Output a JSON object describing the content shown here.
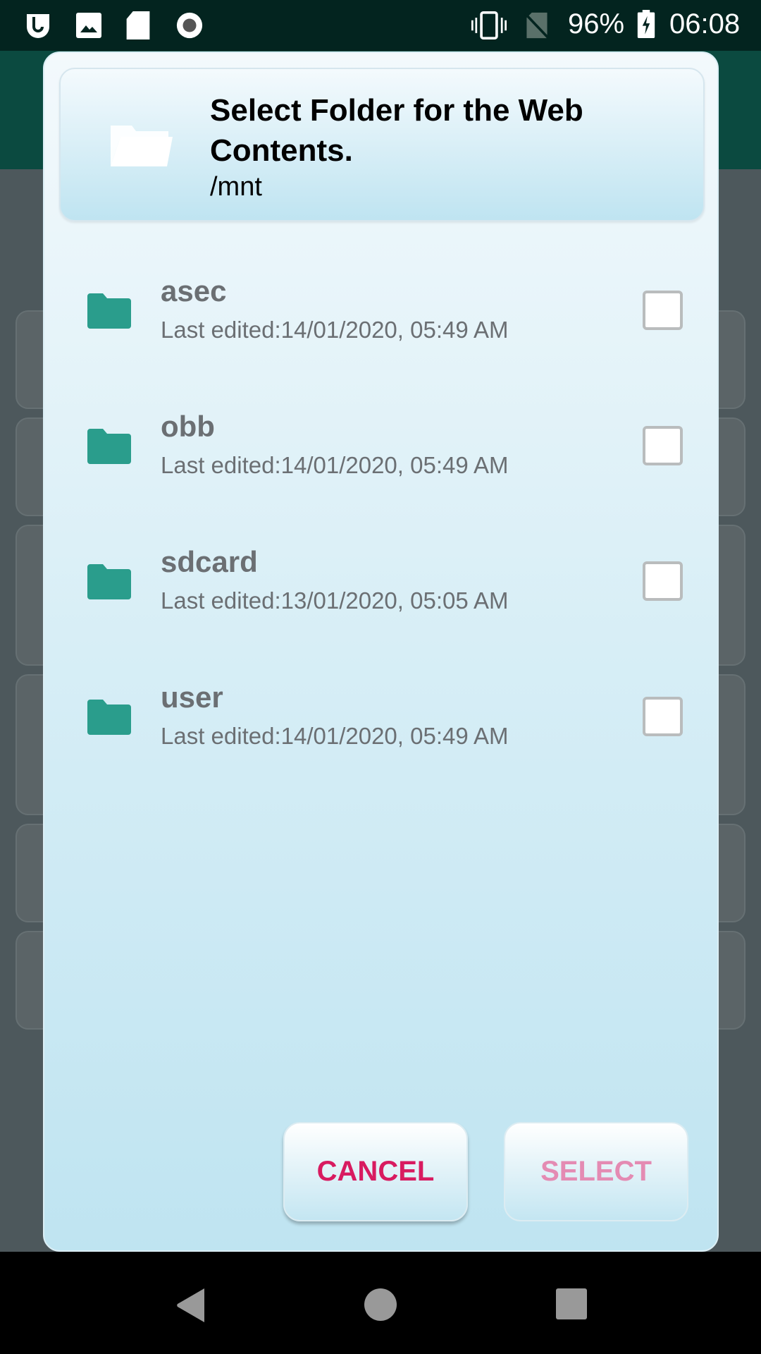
{
  "status_bar": {
    "battery": "96%",
    "time": "06:08",
    "icons": [
      "app-notification-icon",
      "image-icon",
      "sd-card-icon",
      "record-icon",
      "vibrate-icon",
      "no-sim-icon",
      "battery-charging-icon"
    ]
  },
  "dialog": {
    "title": "Select Folder for the Web Contents.",
    "path": "/mnt",
    "header_icon": "folder-open-icon",
    "folders": [
      {
        "name": "asec",
        "meta": "Last edited:14/01/2020, 05:49 AM",
        "checked": false
      },
      {
        "name": "obb",
        "meta": "Last edited:14/01/2020, 05:49 AM",
        "checked": false
      },
      {
        "name": "sdcard",
        "meta": "Last edited:13/01/2020, 05:05 AM",
        "checked": false
      },
      {
        "name": "user",
        "meta": "Last edited:14/01/2020, 05:49 AM",
        "checked": false
      }
    ],
    "cancel_label": "CANCEL",
    "select_label": "SELECT",
    "colors": {
      "folder": "#2a9d8c",
      "cancel": "#d81b60",
      "select_disabled": "#e48bb3"
    }
  },
  "nav_bar": {
    "icons": [
      "back-icon",
      "home-icon",
      "recents-icon"
    ]
  }
}
